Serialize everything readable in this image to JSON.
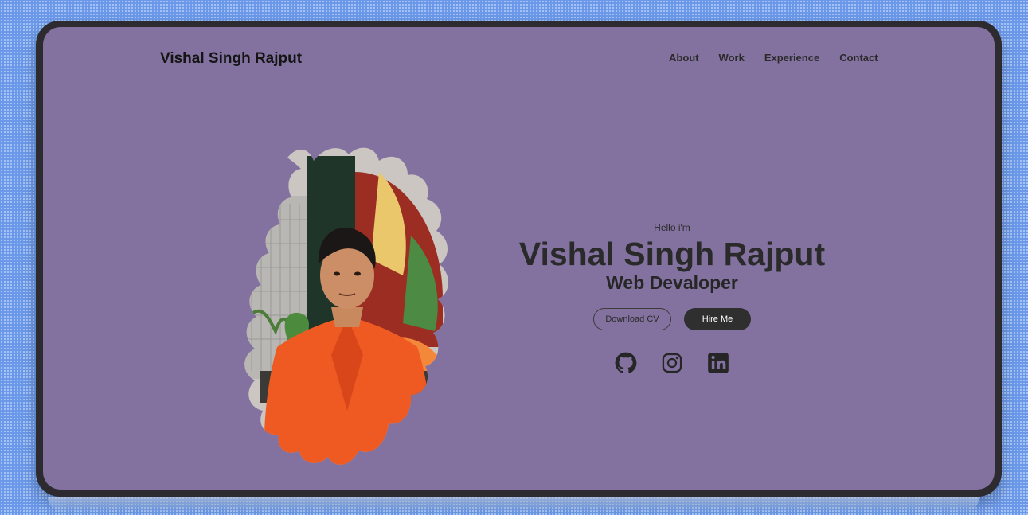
{
  "header": {
    "logo": "Vishal Singh Rajput",
    "nav": [
      "About",
      "Work",
      "Experience",
      "Contact"
    ]
  },
  "hero": {
    "greeting": "Hello i'm",
    "name": "Vishal Singh Rajput",
    "role": "Web Devaloper",
    "download_cv_label": "Download CV",
    "hire_me_label": "Hire Me"
  },
  "socials": [
    "github-icon",
    "instagram-icon",
    "linkedin-icon"
  ],
  "colors": {
    "page_bg": "#6b98e8",
    "screen_bg": "#83729f",
    "device_frame": "#2d2b30",
    "button_dark": "#2f2f2f",
    "shirt_accent": "#ee5a22"
  }
}
